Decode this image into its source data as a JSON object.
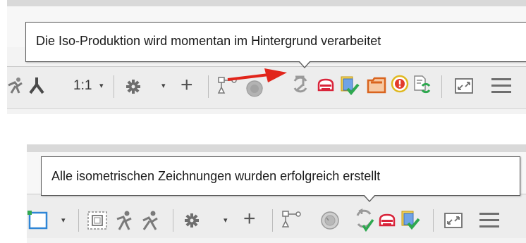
{
  "panel_top": {
    "tooltip": "Die Iso-Produktion wird momentan im Hintergrund verarbeitet",
    "toolbar": {
      "scale_label": "1:1",
      "scale_caret": "▾",
      "settings_caret": "▾",
      "plus": "+",
      "annotation_arrow_color": "#e1251b",
      "icons": [
        "pipe-support-icon",
        "pipe-support-alt-icon",
        "scale-dropdown",
        "settings-gear-icon",
        "add-icon",
        "component-tree-icon",
        "status-circle-icon",
        "iso-processing-icon",
        "print-icon",
        "iso-success-icon",
        "iso-folder-icon",
        "iso-error-icon",
        "iso-refresh-icon",
        "fullscreen-icon",
        "menu-icon"
      ]
    }
  },
  "panel_bottom": {
    "tooltip": "Alle isometrischen Zeichnungen wurden erfolgreich erstellt",
    "toolbar": {
      "frame_caret": "▾",
      "settings_caret": "▾",
      "plus": "+",
      "icons": [
        "frame-select-icon",
        "frame-inset-icon",
        "pipe-support-icon",
        "pipe-support-alt-icon",
        "settings-gear-icon",
        "add-icon",
        "component-tree-icon",
        "status-circle-icon",
        "iso-refresh-icon",
        "print-icon",
        "iso-success-icon",
        "fullscreen-icon",
        "menu-icon"
      ]
    }
  }
}
